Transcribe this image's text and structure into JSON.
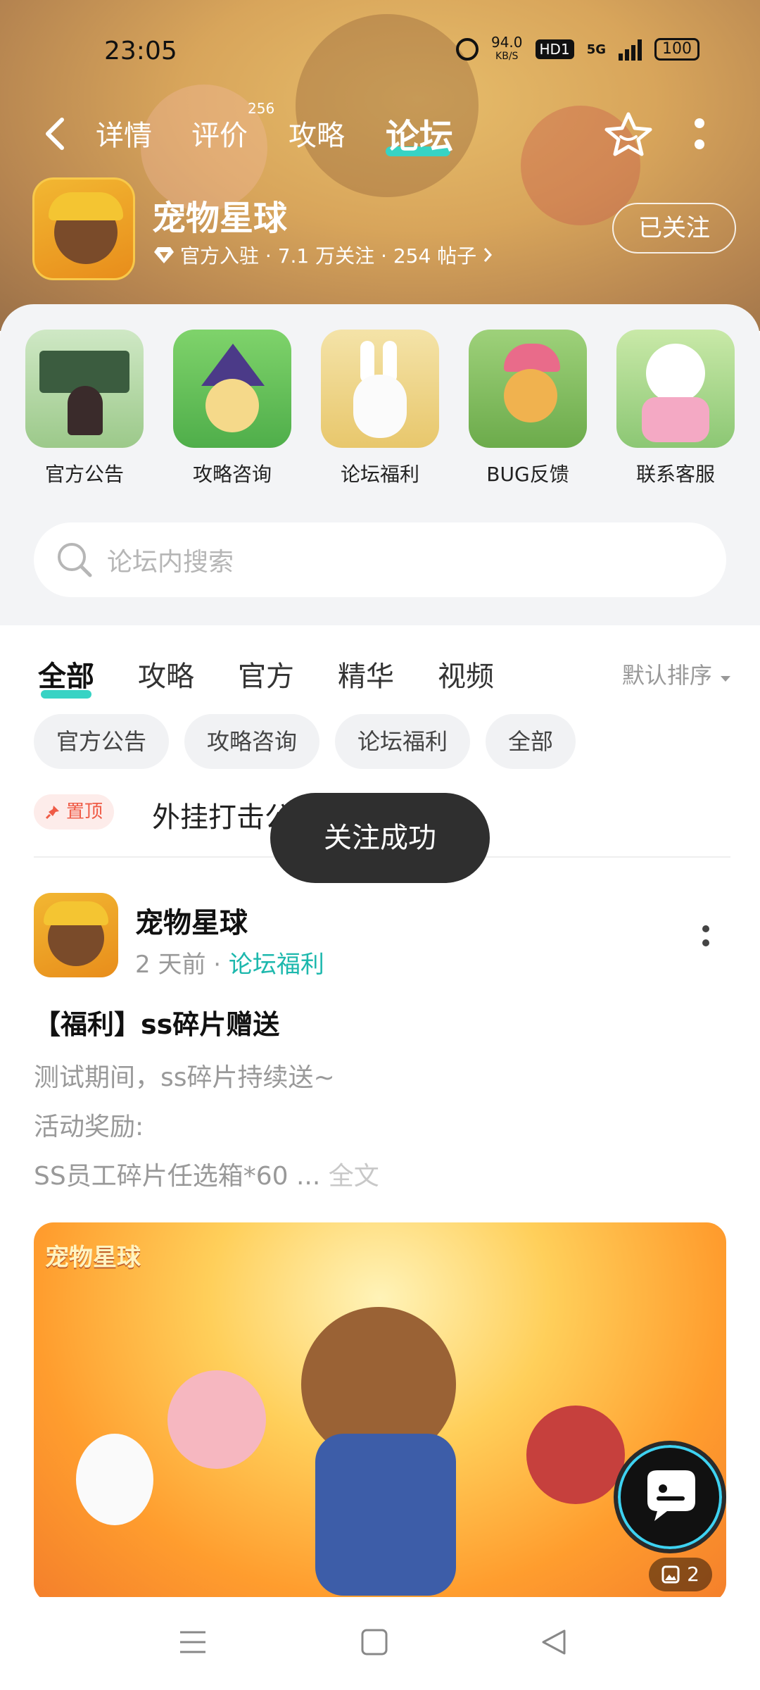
{
  "status": {
    "time": "23:05",
    "net_speed": "94.0",
    "net_unit": "KB/S",
    "hd_label": "HD1",
    "network": "5G",
    "battery": "100"
  },
  "nav": {
    "tabs": [
      {
        "label": "详情"
      },
      {
        "label": "评价",
        "badge": "256"
      },
      {
        "label": "攻略"
      },
      {
        "label": "论坛"
      }
    ]
  },
  "app": {
    "name": "宠物星球",
    "meta": "官方入驻 · 7.1 万关注 · 254 帖子",
    "follow_label": "已关注"
  },
  "categories": [
    {
      "label": "官方公告"
    },
    {
      "label": "攻略咨询"
    },
    {
      "label": "论坛福利"
    },
    {
      "label": "BUG反馈"
    },
    {
      "label": "联系客服"
    }
  ],
  "search": {
    "placeholder": "论坛内搜索"
  },
  "feed_tabs": [
    {
      "label": "全部"
    },
    {
      "label": "攻略"
    },
    {
      "label": "官方"
    },
    {
      "label": "精华"
    },
    {
      "label": "视频"
    }
  ],
  "sort_label": "默认排序",
  "chips": [
    {
      "label": "官方公告"
    },
    {
      "label": "攻略咨询"
    },
    {
      "label": "论坛福利"
    },
    {
      "label": "全部"
    }
  ],
  "pinned": {
    "badge": "置顶",
    "title": "外挂打击公告"
  },
  "toast": "关注成功",
  "post": {
    "author": "宠物星球",
    "time": "2 天前",
    "tag": "论坛福利",
    "title": "【福利】ss碎片赠送",
    "lines": [
      "测试期间，ss碎片持续送~",
      "活动奖励:",
      "SS员工碎片任选箱*60"
    ],
    "ellipsis": " ... ",
    "full_label": "全文",
    "image_logo": "宠物星球",
    "image_count": "2"
  },
  "colors": {
    "accent": "#37d3c4",
    "tag": "#1db8ad",
    "pin": "#ef5b46"
  }
}
